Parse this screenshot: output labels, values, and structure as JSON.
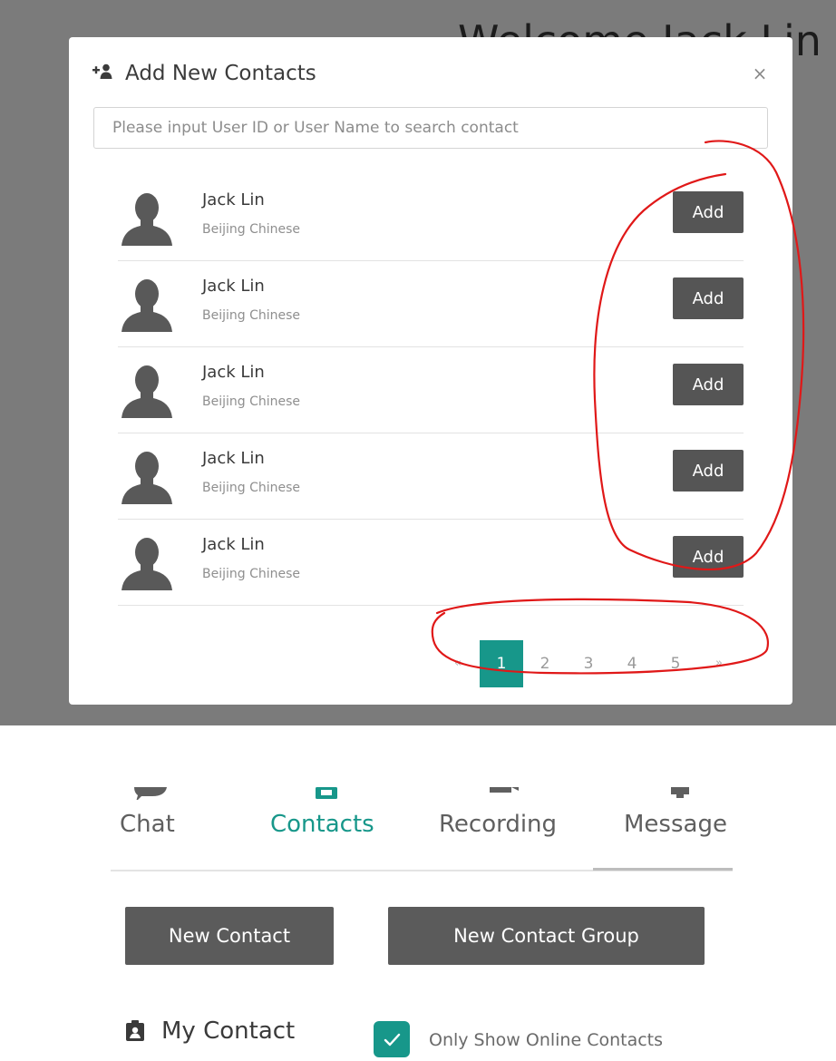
{
  "background": {
    "title": "Welcome Jack Lin"
  },
  "modal": {
    "title": "Add New Contacts",
    "title_icon": "add-person-icon",
    "close_icon": "close-icon",
    "close_glyph": "×",
    "search_placeholder": "Please input User ID or User Name to search contact",
    "contacts": [
      {
        "name": "Jack Lin",
        "location": "Beijing Chinese",
        "button": "Add"
      },
      {
        "name": "Jack Lin",
        "location": "Beijing Chinese",
        "button": "Add"
      },
      {
        "name": "Jack Lin",
        "location": "Beijing Chinese",
        "button": "Add"
      },
      {
        "name": "Jack Lin",
        "location": "Beijing Chinese",
        "button": "Add"
      },
      {
        "name": "Jack Lin",
        "location": "Beijing Chinese",
        "button": "Add"
      }
    ],
    "pagination": {
      "prev": "«",
      "pages": [
        "1",
        "2",
        "3",
        "4",
        "5"
      ],
      "next": "»",
      "active": "1"
    }
  },
  "panel": {
    "tabs": [
      {
        "label": "Chat",
        "icon": "chat-bubble-icon",
        "active": false
      },
      {
        "label": "Contacts",
        "icon": "contact-card-icon",
        "active": true
      },
      {
        "label": "Recording",
        "icon": "video-camera-icon",
        "active": false
      },
      {
        "label": "Message",
        "icon": "bell-icon",
        "active": false
      }
    ],
    "new_contact_button": "New Contact",
    "new_group_button": "New Contact Group",
    "my_contact_label": "My Contact",
    "my_contact_icon": "id-badge-icon",
    "only_online_label": "Only Show Online Contacts",
    "only_online_checked": true
  },
  "colors": {
    "accent": "#17978a",
    "button_dark": "#555555",
    "backdrop": "#7b7b7b",
    "annotation_red": "#e01818"
  }
}
